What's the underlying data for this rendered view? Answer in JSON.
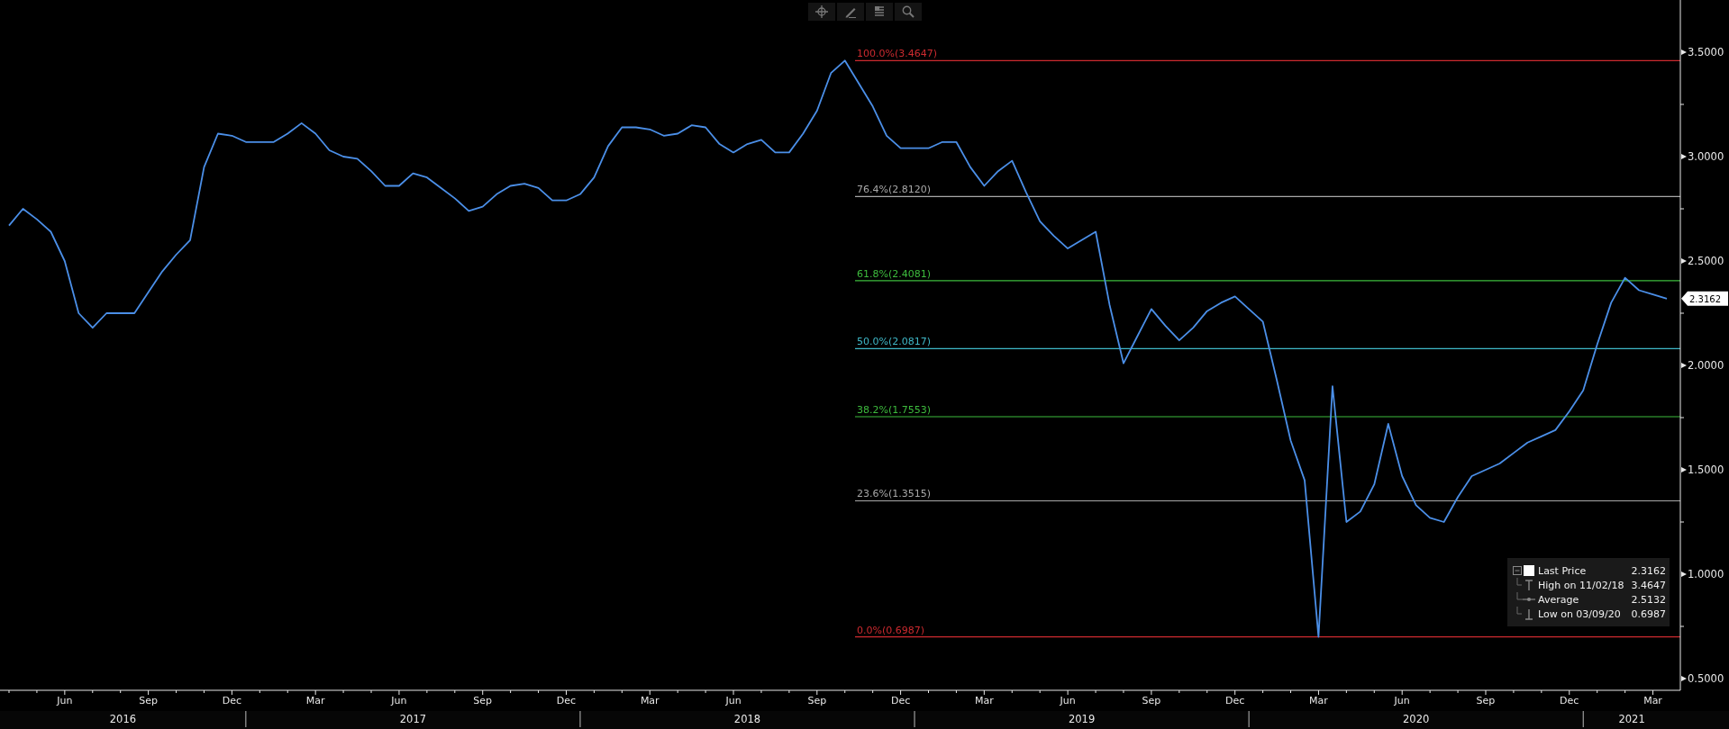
{
  "toolbar": {
    "buttons": [
      {
        "kind": "crosshair"
      },
      {
        "kind": "pencil"
      },
      {
        "kind": "list"
      },
      {
        "kind": "search"
      }
    ]
  },
  "chart": {
    "chart_data": {
      "type": "line",
      "ylim": [
        0.444,
        3.75
      ],
      "categories": [
        null,
        null,
        null,
        null,
        "Jun",
        null,
        null,
        null,
        null,
        null,
        "Sep",
        null,
        null,
        null,
        null,
        null,
        "Dec",
        null,
        null,
        null,
        null,
        null,
        "Mar",
        null,
        null,
        null,
        null,
        null,
        "Jun",
        null,
        null,
        null,
        null,
        null,
        "Sep",
        null,
        null,
        null,
        null,
        null,
        "Dec",
        null,
        null,
        null,
        null,
        null,
        "Mar",
        null,
        null,
        null,
        null,
        null,
        "Jun",
        null,
        null,
        null,
        null,
        null,
        "Sep",
        null,
        null,
        null,
        null,
        null,
        "Dec",
        null,
        null,
        null,
        null,
        null,
        "Mar",
        null,
        null,
        null,
        null,
        null,
        "Jun",
        null,
        null,
        null,
        null,
        null,
        "Sep",
        null,
        null,
        null,
        null,
        null,
        "Dec",
        null,
        null,
        null,
        null,
        null,
        "Mar",
        null,
        null,
        null,
        null,
        null,
        "Jun",
        null,
        null,
        null,
        null,
        null,
        "Sep",
        null,
        null,
        null,
        null,
        null,
        "Dec",
        null,
        null,
        null,
        null,
        null,
        "Mar",
        null
      ],
      "series": [
        {
          "name": "Last Price",
          "color": "#4b8fe8",
          "values": [
            2.67,
            2.75,
            2.7,
            2.64,
            2.5,
            2.25,
            2.18,
            2.25,
            2.25,
            2.25,
            2.35,
            2.45,
            2.53,
            2.6,
            2.95,
            3.11,
            3.1,
            3.07,
            3.07,
            3.07,
            3.11,
            3.16,
            3.11,
            3.03,
            3.0,
            2.99,
            2.93,
            2.86,
            2.86,
            2.92,
            2.9,
            2.85,
            2.8,
            2.74,
            2.76,
            2.82,
            2.86,
            2.87,
            2.85,
            2.79,
            2.79,
            2.82,
            2.9,
            3.05,
            3.14,
            3.14,
            3.13,
            3.1,
            3.11,
            3.15,
            3.14,
            3.06,
            3.02,
            3.06,
            3.08,
            3.02,
            3.02,
            3.11,
            3.22,
            3.4,
            3.46,
            3.35,
            3.24,
            3.1,
            3.04,
            3.04,
            3.04,
            3.07,
            3.07,
            2.95,
            2.86,
            2.93,
            2.98,
            2.83,
            2.69,
            2.62,
            2.56,
            2.6,
            2.64,
            2.29,
            2.01,
            2.14,
            2.27,
            2.19,
            2.12,
            2.18,
            2.26,
            2.3,
            2.33,
            2.27,
            2.21,
            1.93,
            1.64,
            1.45,
            0.7,
            1.9,
            1.25,
            1.3,
            1.43,
            1.72,
            1.47,
            1.33,
            1.27,
            1.25,
            1.37,
            1.47,
            1.5,
            1.53,
            1.58,
            1.63,
            1.66,
            1.69,
            1.78,
            1.88,
            2.1,
            2.3,
            2.42,
            2.36,
            2.34,
            2.32
          ]
        }
      ],
      "yticks": [
        {
          "value": 3.5,
          "label": "3.5000"
        },
        {
          "value": 3.0,
          "label": "3.0000"
        },
        {
          "value": 2.5,
          "label": "2.5000"
        },
        {
          "value": 2.0,
          "label": "2.0000"
        },
        {
          "value": 1.5,
          "label": "1.5000"
        },
        {
          "value": 1.0,
          "label": "1.0000"
        },
        {
          "value": 0.5,
          "label": "0.5000"
        }
      ]
    },
    "fibonacci_levels": [
      {
        "label": "100.0%(3.4647)",
        "color": "#cc2a2f"
      },
      {
        "label": "76.4%(2.8120)",
        "color": "#a8a8a8"
      },
      {
        "label": "61.8%(2.4081)",
        "color": "#3dbb3d"
      },
      {
        "label": "50.0%(2.0817)",
        "color": "#3fb8c8"
      },
      {
        "label": "38.2%(1.7553)",
        "color": "#3dbb3d"
      },
      {
        "label": "23.6%(1.3515)",
        "color": "#a8a8a8"
      },
      {
        "label": "0.0%(0.6987)",
        "color": "#cc2a2f"
      }
    ],
    "year_labels": [
      "2016",
      "2017",
      "2018",
      "2019",
      "2020",
      "2021"
    ],
    "last_price_tag": "2.3162",
    "legend": {
      "expanded": true,
      "items": [
        {
          "kind": "last",
          "value": "2.3162"
        },
        {
          "kind": "high",
          "label": "High on 11/02/18",
          "value": "3.4647"
        },
        {
          "kind": "average",
          "label": "Average",
          "value": "2.5132"
        },
        {
          "kind": "low",
          "label": "Low on 03/09/20",
          "value": "0.6987"
        }
      ]
    }
  }
}
